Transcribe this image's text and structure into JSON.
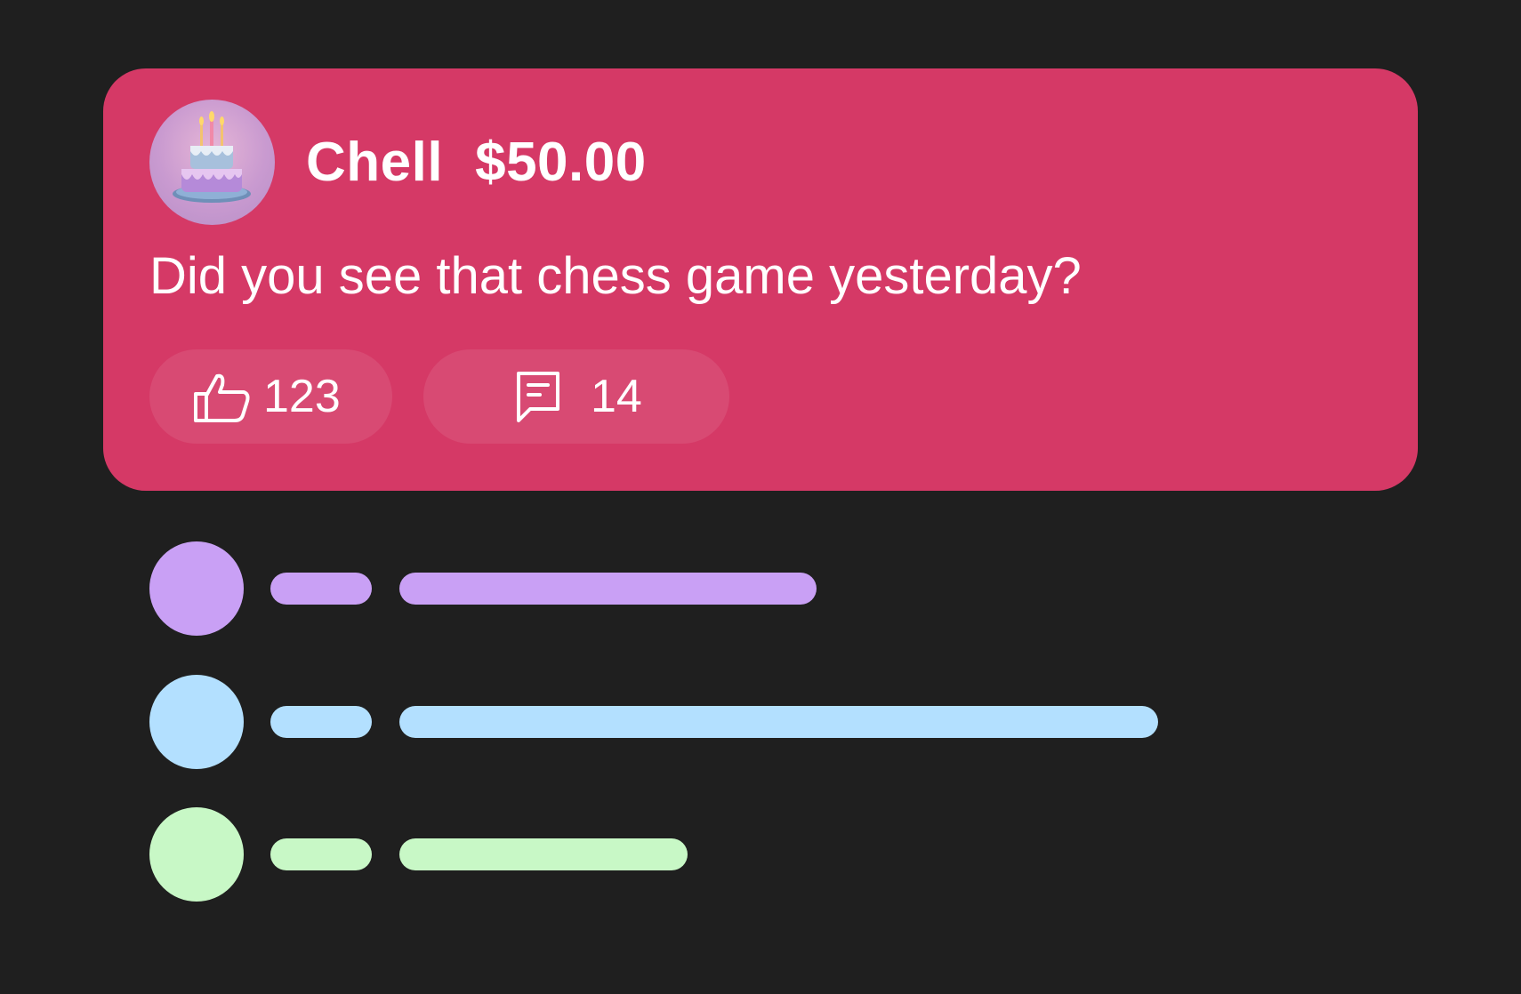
{
  "post": {
    "author": "Chell",
    "amount": "$50.00",
    "message": "Did you see that chess game yesterday?",
    "avatar_icon": "birthday-cake-icon",
    "likes_icon": "thumbs-up-icon",
    "comments_icon": "comment-icon",
    "likes_count": "123",
    "comments_count": "14",
    "card_color": "#d53966"
  },
  "placeholder_rows": [
    {
      "color": "#c9a0f5",
      "line_fraction": 0.55
    },
    {
      "color": "#b3e0ff",
      "line_fraction": 1.0
    },
    {
      "color": "#c8f8c6",
      "line_fraction": 0.38
    }
  ]
}
